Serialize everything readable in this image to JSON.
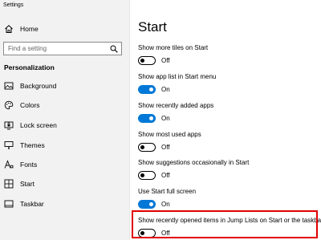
{
  "app": {
    "title": "Settings"
  },
  "sidebar": {
    "home_label": "Home",
    "search_placeholder": "Find a setting",
    "section_title": "Personalization",
    "items": [
      {
        "label": "Background",
        "icon": "image-icon"
      },
      {
        "label": "Colors",
        "icon": "palette-icon"
      },
      {
        "label": "Lock screen",
        "icon": "lock-screen-icon"
      },
      {
        "label": "Themes",
        "icon": "themes-brush-icon"
      },
      {
        "label": "Fonts",
        "icon": "fonts-icon"
      },
      {
        "label": "Start",
        "icon": "start-grid-icon"
      },
      {
        "label": "Taskbar",
        "icon": "taskbar-icon"
      }
    ]
  },
  "main": {
    "title": "Start",
    "settings": [
      {
        "label": "Show more tiles on Start",
        "state": "Off"
      },
      {
        "label": "Show app list in Start menu",
        "state": "On"
      },
      {
        "label": "Show recently added apps",
        "state": "On"
      },
      {
        "label": "Show most used apps",
        "state": "Off"
      },
      {
        "label": "Show suggestions occasionally in Start",
        "state": "Off"
      },
      {
        "label": "Use Start full screen",
        "state": "On"
      },
      {
        "label": "Show recently opened items in Jump Lists on Start or the taskbar",
        "state": "Off"
      }
    ]
  },
  "colors": {
    "accent": "#0078d7",
    "highlight_border": "#e00000",
    "sidebar_bg": "#f2f2f2"
  }
}
